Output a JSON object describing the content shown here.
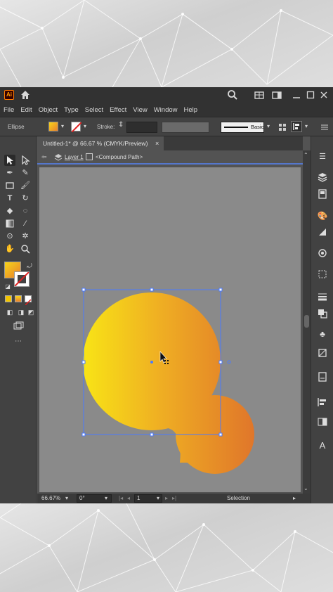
{
  "app": {
    "logo_text": "Ai",
    "colors": {
      "accent": "#ff7c00",
      "selection": "#4a7aff",
      "gradient_start": "#f7d41a",
      "gradient_end": "#e8802b"
    }
  },
  "menu": [
    "File",
    "Edit",
    "Object",
    "Type",
    "Select",
    "Effect",
    "View",
    "Window",
    "Help"
  ],
  "control_bar": {
    "object_label": "Ellipse",
    "stroke_label": "Stroke:",
    "style_label": "Basic"
  },
  "document": {
    "tab_title": "Untitled-1* @ 66.67 % (CMYK/Preview)",
    "tab_close": "×",
    "breadcrumb_layer": "Layer 1",
    "breadcrumb_object": "<Compound Path>"
  },
  "status": {
    "zoom": "66.67%",
    "rotation": "0°",
    "page": "1",
    "tool": "Selection"
  },
  "icons": {
    "home": "home-icon",
    "search": "search-icon",
    "arrange": "arrange-documents-icon",
    "window_min": "minimize-icon",
    "window_max": "maximize-icon",
    "window_close": "close-icon"
  }
}
